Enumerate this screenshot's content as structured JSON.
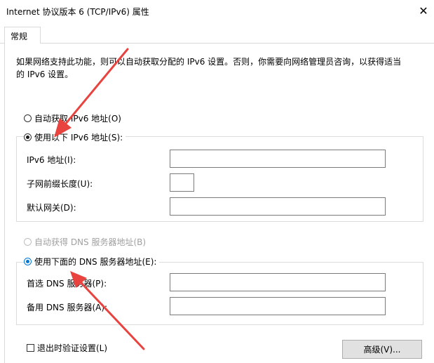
{
  "window": {
    "title": "Internet 协议版本 6 (TCP/IPv6) 属性",
    "close_glyph": "✕"
  },
  "tabs": [
    {
      "label": "常规"
    }
  ],
  "general": {
    "description": "如果网络支持此功能，则可以自动获取分配的 IPv6 设置。否则，你需要向网络管理员咨询，以获得适当的 IPv6 设置。",
    "ip_options": {
      "auto_label": "自动获取 IPv6 地址(O)",
      "manual_label": "使用以下 IPv6 地址(S):",
      "selected": "manual"
    },
    "ip_fields": {
      "address_label": "IPv6 地址(I):",
      "address_value": "",
      "prefix_label": "子网前缀长度(U):",
      "prefix_value": "",
      "gateway_label": "默认网关(D):",
      "gateway_value": ""
    },
    "dns_options": {
      "auto_label": "自动获得 DNS 服务器地址(B)",
      "manual_label": "使用下面的 DNS 服务器地址(E):",
      "selected": "manual"
    },
    "dns_fields": {
      "preferred_label": "首选 DNS 服务器(P):",
      "preferred_value": "",
      "alternate_label": "备用 DNS 服务器(A):",
      "alternate_value": ""
    },
    "validate_on_exit": {
      "label": "退出时验证设置(L)",
      "checked": false
    },
    "advanced_button": "高级(V)..."
  },
  "colors": {
    "annotation_arrow": "#e8433f",
    "radio_accent": "#0078d7"
  }
}
